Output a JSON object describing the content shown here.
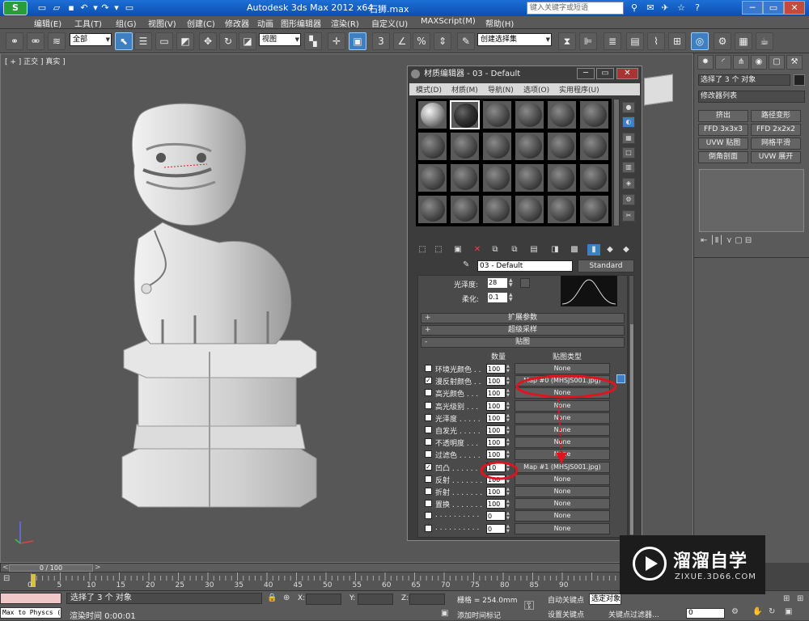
{
  "titlebar": {
    "app_title": "Autodesk 3ds Max  2012 x64",
    "file_name": "石狮.max",
    "search_placeholder": "键入关键字或短语"
  },
  "menu": [
    "编辑(E)",
    "工具(T)",
    "组(G)",
    "视图(V)",
    "创建(C)",
    "修改器",
    "动画",
    "图形编辑器",
    "渲染(R)",
    "自定义(U)",
    "MAXScript(M)",
    "帮助(H)"
  ],
  "toolbar": {
    "selection_filter": "全部",
    "ref_coord": "视图",
    "named_selection": "创建选择集"
  },
  "viewport": {
    "label": "[ + ] 正交 ] 真实 ]"
  },
  "command_panel": {
    "selection_info": "选择了 3 个 对象",
    "modifier_list": "修改器列表",
    "buttons": [
      "挤出",
      "路径变形",
      "FFD 3x3x3",
      "FFD 2x2x2",
      "UVW 贴图",
      "网格平滑",
      "倒角剖面",
      "UVW 展开"
    ]
  },
  "material_editor": {
    "title": "材质编辑器 - 03 - Default",
    "menu": [
      "模式(D)",
      "材质(M)",
      "导航(N)",
      "选项(O)",
      "实用程序(U)"
    ],
    "material_name": "03 - Default",
    "material_type": "Standard",
    "glossiness_label": "光泽度:",
    "glossiness_value": "28",
    "soften_label": "柔化:",
    "soften_value": "0.1",
    "rollouts": [
      "扩展参数",
      "超级采样",
      "贴图"
    ],
    "maps_header": {
      "amount": "数量",
      "map_type": "贴图类型"
    },
    "maps": [
      {
        "label": "环境光颜色 . .",
        "checked": false,
        "amount": "100",
        "map": "None"
      },
      {
        "label": "漫反射颜色 . .",
        "checked": true,
        "amount": "100",
        "map": "Map #0 (MHSJS001.jpg)"
      },
      {
        "label": "高光颜色 . . .",
        "checked": false,
        "amount": "100",
        "map": "None"
      },
      {
        "label": "高光级别 . . .",
        "checked": false,
        "amount": "100",
        "map": "None"
      },
      {
        "label": "光泽度 . . . . .",
        "checked": false,
        "amount": "100",
        "map": "None"
      },
      {
        "label": "自发光 . . . . .",
        "checked": false,
        "amount": "100",
        "map": "None"
      },
      {
        "label": "不透明度 . . .",
        "checked": false,
        "amount": "100",
        "map": "None"
      },
      {
        "label": "过滤色 . . . . .",
        "checked": false,
        "amount": "100",
        "map": "None"
      },
      {
        "label": "凹凸 . . . . . . .",
        "checked": true,
        "amount": "10",
        "map": "Map #1 (MHSJS001.jpg)"
      },
      {
        "label": "反射 . . . . . . .",
        "checked": false,
        "amount": "100",
        "map": "None"
      },
      {
        "label": "折射 . . . . . . .",
        "checked": false,
        "amount": "100",
        "map": "None"
      },
      {
        "label": "置换 . . . . . . .",
        "checked": false,
        "amount": "100",
        "map": "None"
      },
      {
        "label": ". . . . . . . . . .",
        "checked": false,
        "amount": "0",
        "map": "None"
      },
      {
        "label": ". . . . . . . . . .",
        "checked": false,
        "amount": "0",
        "map": "None"
      }
    ]
  },
  "timeline": {
    "frame_counter": "0 / 100",
    "ticks": [
      "0",
      "5",
      "10",
      "15",
      "20",
      "25",
      "30",
      "35",
      "40",
      "45",
      "50",
      "55",
      "60",
      "65",
      "70",
      "75",
      "80",
      "85",
      "90"
    ]
  },
  "status": {
    "script_listener": "Max to Physcs (",
    "selection": "选择了 3 个 对象",
    "render_time": "渲染时间  0:00:01",
    "x_label": "X:",
    "y_label": "Y:",
    "z_label": "Z:",
    "grid": "栅格 = 254.0mm",
    "add_time_tag": "添加时间标记",
    "auto_key": "自动关键点",
    "set_key": "设置关键点",
    "selected_set": "选定对象",
    "key_filters": "关键点过滤器...",
    "current_frame": "0"
  },
  "watermark": {
    "text": "溜溜自学",
    "url": "ZIXUE.3D66.COM"
  },
  "annotation_color": "#e0141e"
}
